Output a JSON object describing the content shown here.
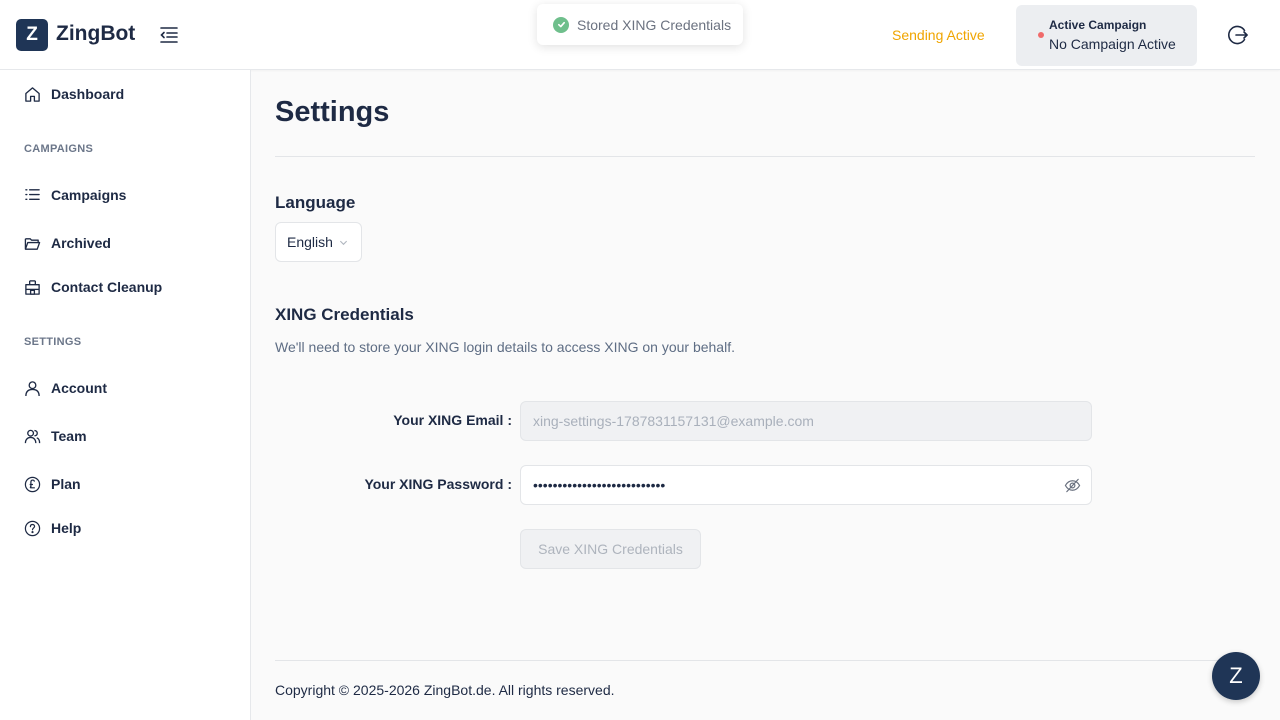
{
  "header": {
    "logo_letter": "Z",
    "app_name": "ZingBot",
    "toast": "Stored XING Credentials",
    "sending_status": "Sending Active",
    "campaign_title": "Active Campaign",
    "campaign_value": "No Campaign Active"
  },
  "sidebar": {
    "dashboard": "Dashboard",
    "section_campaigns": "CAMPAIGNS",
    "campaigns": "Campaigns",
    "archived": "Archived",
    "contact_cleanup": "Contact Cleanup",
    "section_settings": "SETTINGS",
    "account": "Account",
    "team": "Team",
    "plan": "Plan",
    "help": "Help"
  },
  "main": {
    "title": "Settings",
    "language_title": "Language",
    "language_value": "English",
    "credentials_title": "XING Credentials",
    "credentials_desc": "We'll need to store your XING login details to access XING on your behalf.",
    "email_label": "Your XING Email",
    "email_value": "xing-settings-1787831157131@example.com",
    "password_label": "Your XING Password",
    "password_value": "•••••••••••••••••••••••••••",
    "save_label": "Save XING Credentials",
    "footer": "Copyright © 2025-2026 ZingBot.de. All rights reserved."
  },
  "chat": {
    "letter": "Z"
  },
  "colors": {
    "brand": "#1f3556",
    "warning": "#f0a500",
    "success": "#6fbf8c",
    "danger": "#f06a6a"
  },
  "icons": [
    "collapse-menu-icon",
    "check-icon",
    "logout-icon",
    "home-icon",
    "list-icon",
    "folder-icon",
    "building-icon",
    "user-icon",
    "team-icon",
    "pound-icon",
    "help-icon",
    "chevron-down-icon",
    "eye-off-icon"
  ]
}
